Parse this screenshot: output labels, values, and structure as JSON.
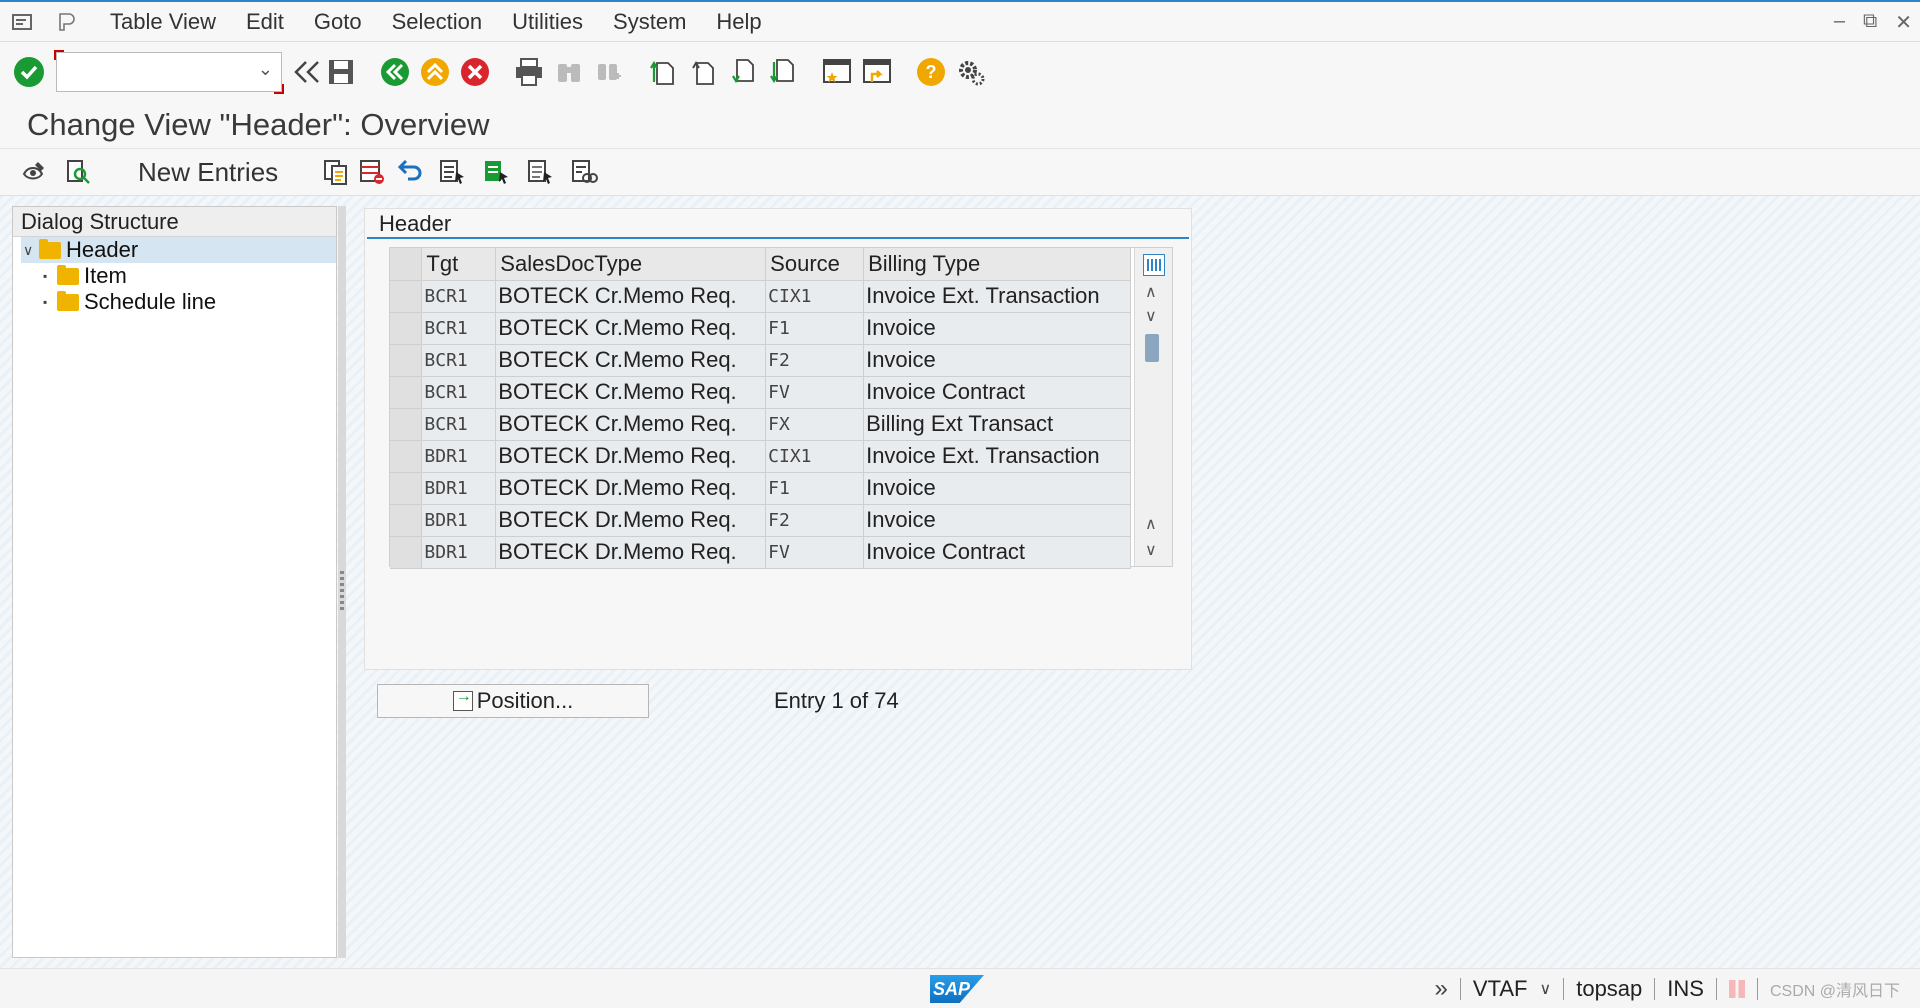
{
  "menubar": {
    "items": [
      "Table View",
      "Edit",
      "Goto",
      "Selection",
      "Utilities",
      "System",
      "Help"
    ]
  },
  "toolbar": {
    "command_field_value": ""
  },
  "title": "Change View \"Header\": Overview",
  "appbar": {
    "new_entries_label": "New Entries"
  },
  "dialog_structure": {
    "heading": "Dialog Structure",
    "nodes": [
      {
        "label": "Header",
        "selected": true
      },
      {
        "label": "Item",
        "selected": false
      },
      {
        "label": "Schedule line",
        "selected": false
      }
    ]
  },
  "header_panel": {
    "title": "Header",
    "columns": [
      "Tgt",
      "SalesDocType",
      "Source",
      "Billing Type"
    ],
    "rows": [
      [
        "BCR1",
        "BOTECK Cr.Memo Req.",
        "CIX1",
        "Invoice Ext. Transaction"
      ],
      [
        "BCR1",
        "BOTECK Cr.Memo Req.",
        "F1",
        "Invoice"
      ],
      [
        "BCR1",
        "BOTECK Cr.Memo Req.",
        "F2",
        "Invoice"
      ],
      [
        "BCR1",
        "BOTECK Cr.Memo Req.",
        "FV",
        "Invoice Contract"
      ],
      [
        "BCR1",
        "BOTECK Cr.Memo Req.",
        "FX",
        "Billing Ext Transact"
      ],
      [
        "BDR1",
        "BOTECK Dr.Memo Req.",
        "CIX1",
        "Invoice Ext. Transaction"
      ],
      [
        "BDR1",
        "BOTECK Dr.Memo Req.",
        "F1",
        "Invoice"
      ],
      [
        "BDR1",
        "BOTECK Dr.Memo Req.",
        "F2",
        "Invoice"
      ],
      [
        "BDR1",
        "BOTECK Dr.Memo Req.",
        "FV",
        "Invoice Contract"
      ]
    ]
  },
  "position_button_label": "Position...",
  "entry_info": "Entry 1 of 74",
  "statusbar": {
    "logo_text": "SAP",
    "transaction": "VTAF",
    "system": "topsap",
    "mode": "INS",
    "watermark": "CSDN @清风日下"
  },
  "colors": {
    "accent": "#2e84c6",
    "ok_green": "#1a9a32",
    "cancel_red": "#d9262c",
    "help_orange": "#f0a800"
  }
}
